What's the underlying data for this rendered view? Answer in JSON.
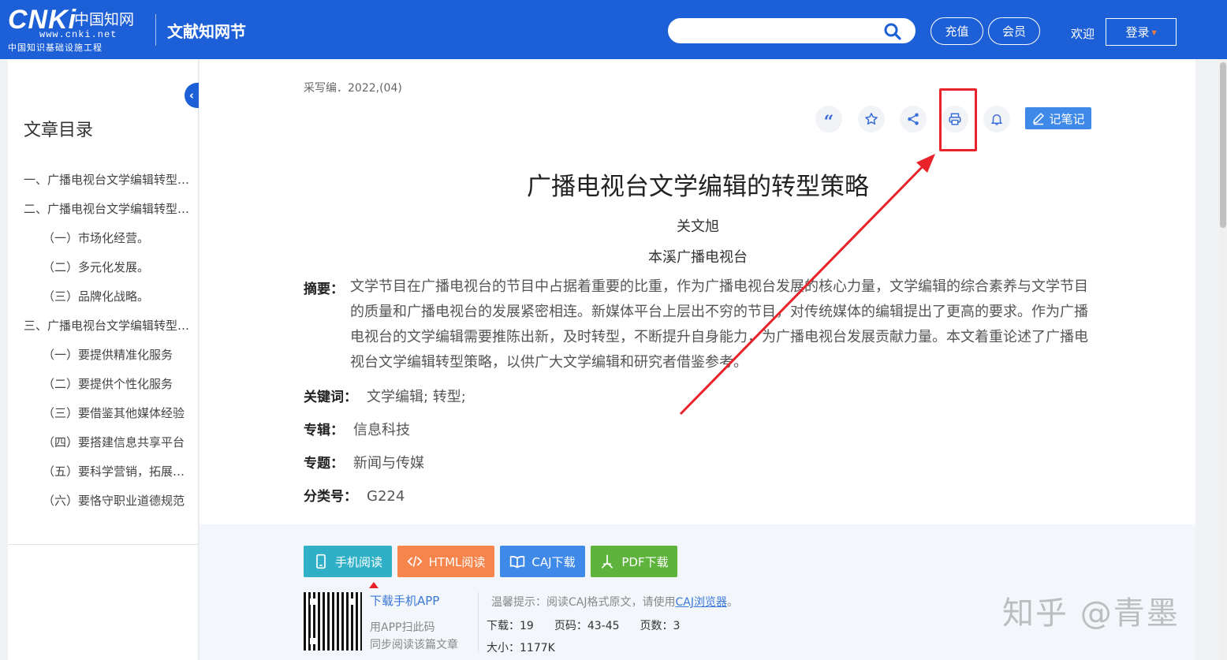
{
  "header": {
    "logo": {
      "brand": "CNKi",
      "brand_cn": "中国知网",
      "url": "www.cnki.net",
      "subtitle": "中国知识基础设施工程"
    },
    "site_name": "文献知网节",
    "search": {
      "placeholder": ""
    },
    "recharge_label": "充值",
    "member_label": "会员",
    "welcome_label": "欢迎",
    "login_label": "登录",
    "accent": "#1d5fd6"
  },
  "sidebar": {
    "collapse_glyph": "‹",
    "title": "文章目录",
    "items": [
      {
        "label": "一、广播电视台文学编辑转型的必要性"
      },
      {
        "label": "二、广播电视台文学编辑转型的方向"
      },
      {
        "label": "（一）市场化经营。"
      },
      {
        "label": "（二）多元化发展。"
      },
      {
        "label": "（三）品牌化战略。"
      },
      {
        "label": "三、广播电视台文学编辑转型的策略"
      },
      {
        "label": "（一）要提供精准化服务"
      },
      {
        "label": "（二）要提供个性化服务"
      },
      {
        "label": "（三）要借鉴其他媒体经验"
      },
      {
        "label": "（四）要搭建信息共享平台"
      },
      {
        "label": "（五）要科学营销，拓展渠道"
      },
      {
        "label": "（六）要恪守职业道德规范"
      }
    ]
  },
  "article": {
    "source": "采写编．2022,(04)",
    "note_label": "记笔记",
    "title": "广播电视台文学编辑的转型策略",
    "author": "关文旭",
    "organization": "本溪广播电视台",
    "abstract_label": "摘要：",
    "abstract": "文学节目在广播电视台的节目中占据着重要的比重，作为广播电视台发展的核心力量，文学编辑的综合素养与文学节目的质量和广播电视台的发展紧密相连。新媒体平台上层出不穷的节目，对传统媒体的编辑提出了更高的要求。作为广播电视台的文学编辑需要推陈出新，及时转型，不断提升自身能力，为广播电视台发展贡献力量。本文着重论述了广播电视台文学编辑转型策略，以供广大文学编辑和研究者借鉴参考。",
    "keywords_label": "关键词：",
    "keywords": "文学编辑;  转型;",
    "album_label": "专辑：",
    "album": "信息科技",
    "topic_label": "专题：",
    "topic": "新闻与传媒",
    "class_label": "分类号：",
    "class_no": "G224"
  },
  "downloads": {
    "mobile_label": "手机阅读",
    "html_label": "HTML阅读",
    "caj_label": "CAJ下载",
    "pdf_label": "PDF下载",
    "colors": {
      "mobile": "#2fb0c7",
      "html": "#f6844b",
      "caj": "#3f8ae8",
      "pdf": "#5db33b"
    },
    "app_link": "下载手机APP",
    "app_scan": "用APP扫此码",
    "app_sync": "同步阅读该篇文章",
    "tip_prefix": "温馨提示：阅读CAJ格式原文，请使用",
    "tip_link": "CAJ浏览器",
    "tip_suffix": "。",
    "downloads_stat": "下载：19",
    "pages_range": "页码：43-45",
    "page_count": "页数：3",
    "size": "大小：1177K"
  },
  "watermark": "知乎 @青墨",
  "annotation_color": "#e8232a"
}
